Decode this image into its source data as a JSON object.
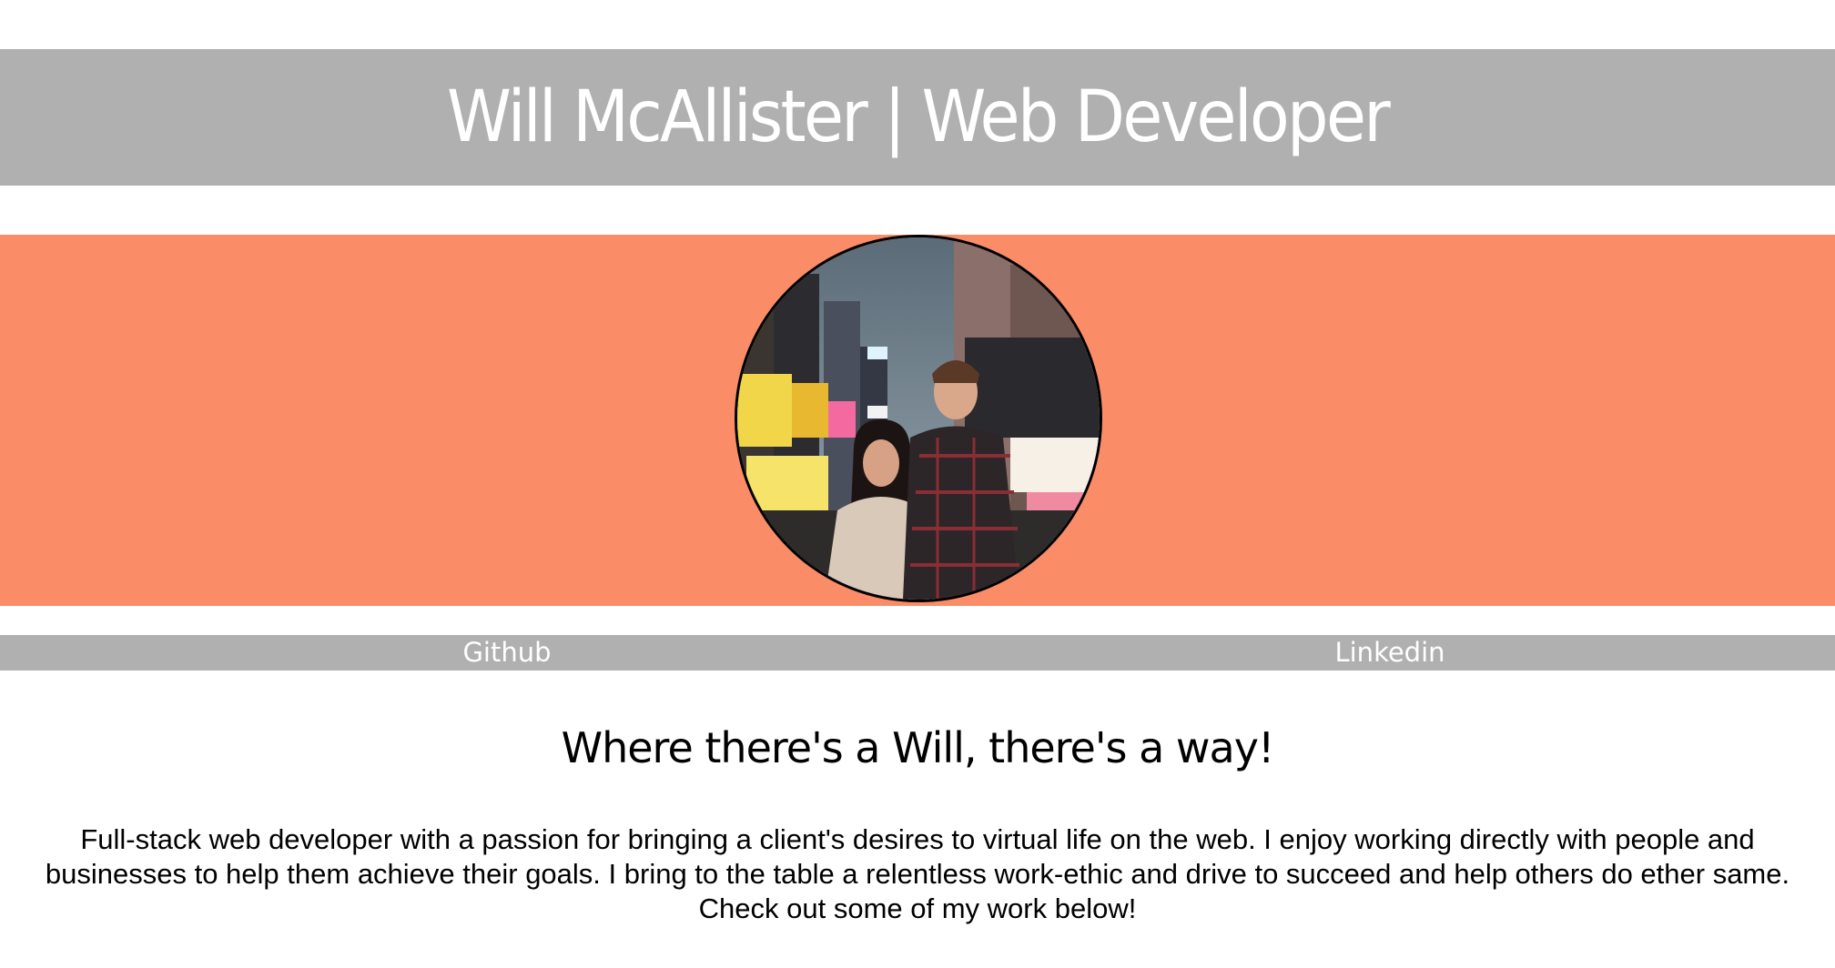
{
  "header": {
    "title": "Will McAllister | Web Developer"
  },
  "hero": {
    "avatar_alt": "Will McAllister in Times Square",
    "background_color": "#fb8c68"
  },
  "nav": {
    "github_label": "Github",
    "linkedin_label": "Linkedin"
  },
  "about": {
    "tagline": "Where there's a Will, there's a way!",
    "bio": "Full-stack web developer with a passion for bringing a client's desires to virtual life on the web. I enjoy working directly with people and businesses to help them achieve their goals. I bring to the table a relentless work-ethic and drive to succeed and help others do ether same. Check out some of my work below!"
  },
  "colors": {
    "header_gray": "#b0b0b0",
    "accent_salmon": "#fb8c68",
    "text_white": "#ffffff",
    "text_black": "#000000"
  }
}
